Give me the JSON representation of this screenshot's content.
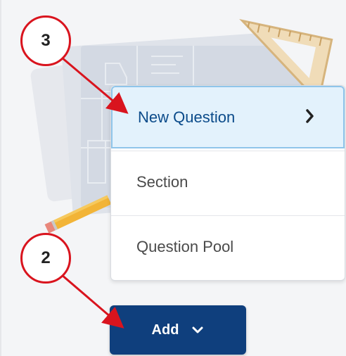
{
  "menu": {
    "items": [
      {
        "label": "New Question",
        "icon": "chevron-right-icon"
      },
      {
        "label": "Section"
      },
      {
        "label": "Question Pool"
      }
    ]
  },
  "add_button": {
    "label": "Add",
    "icon": "chevron-down-icon"
  },
  "annotations": {
    "step3": "3",
    "step2": "2"
  },
  "colors": {
    "accent": "#0f3f7d",
    "highlight": "#e3f2fc",
    "annotation": "#d9141e"
  }
}
